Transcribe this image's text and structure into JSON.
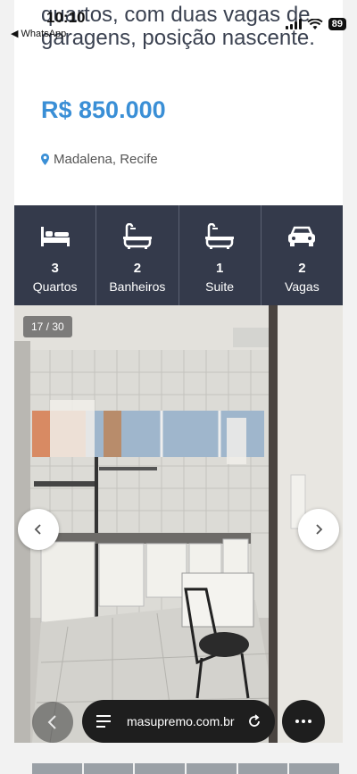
{
  "status_bar": {
    "time": "10:10",
    "back_app": "◀ WhatsApp",
    "battery": "89"
  },
  "listing": {
    "description": "quartos, com duas vagas de garagens, posição nascente.",
    "price": "R$ 850.000",
    "location": "Madalena, Recife",
    "accent_color": "#3a8fd6"
  },
  "features": [
    {
      "icon": "bed-icon",
      "value": "3",
      "label": "Quartos"
    },
    {
      "icon": "bathtub-icon",
      "value": "2",
      "label": "Banheiros"
    },
    {
      "icon": "bathtub-icon",
      "value": "1",
      "label": "Suite"
    },
    {
      "icon": "car-icon",
      "value": "2",
      "label": "Vagas"
    }
  ],
  "gallery": {
    "counter": "17 / 30"
  },
  "browser": {
    "url": "masupremo.com.br"
  }
}
